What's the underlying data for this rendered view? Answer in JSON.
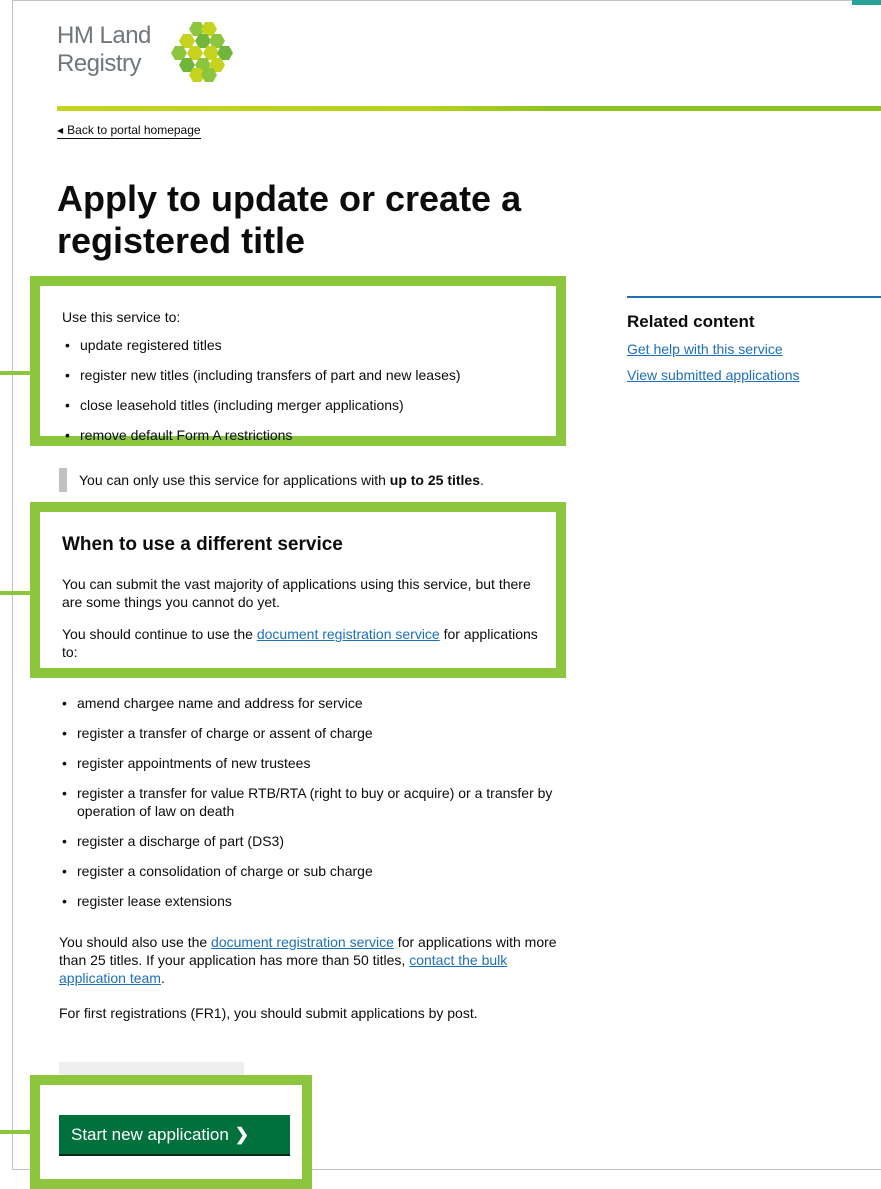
{
  "brand": {
    "line1": "HM Land",
    "line2": "Registry"
  },
  "back_link": "Back to portal homepage",
  "title": "Apply to update or create a registered title",
  "intro": {
    "lead": "Use this service to:",
    "items": [
      "update registered titles",
      "register new titles (including transfers of part and new leases)",
      "close leasehold titles (including merger applications)",
      "remove default Form A restrictions"
    ]
  },
  "inset": {
    "text_before": "You can only use this service for applications with ",
    "bold": "up to 25 titles",
    "text_after": "."
  },
  "different_service": {
    "heading": "When to use a different service",
    "p1": "You can submit the vast majority of applications using this service, but there are some things you cannot do yet.",
    "p2_before": "You should continue to use the ",
    "p2_link": "document registration service",
    "p2_after": " for applications to:"
  },
  "different_items": [
    "amend chargee name and address for service",
    "register a transfer of charge or assent of charge",
    "register appointments of new trustees",
    "register a transfer for value RTB/RTA (right to buy or acquire) or a transfer by operation of law on death",
    "register a discharge of part (DS3)",
    "register a consolidation of charge or sub charge",
    "register lease extensions"
  ],
  "also": {
    "before": "You should also use the ",
    "link1": "document registration service",
    "middle": " for applications with more than 25 titles. If your application has more than 50 titles, ",
    "link2": "contact the bulk application team",
    "after": "."
  },
  "first_registrations": "For first registrations (FR1), you should submit applications by post.",
  "primary_button": "Start new application",
  "related": {
    "heading": "Related content",
    "links": [
      "Get help with this service",
      "View submitted applications"
    ]
  },
  "colors": {
    "highlight": "#8cc63f",
    "button": "#00703c",
    "link": "#1d70b8"
  }
}
